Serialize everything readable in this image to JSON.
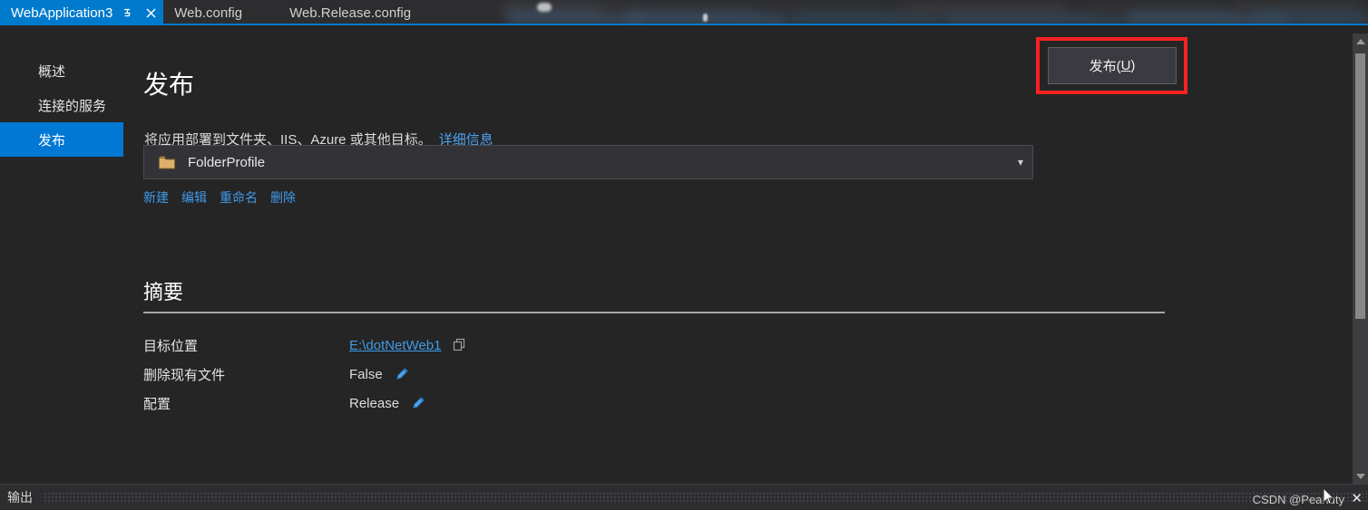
{
  "tabs": [
    {
      "label": "WebApplication3",
      "active": true,
      "pin_icon": "pin-icon",
      "close_icon": "close-icon"
    },
    {
      "label": "Web.config",
      "active": false
    },
    {
      "label": "Web.Release.config",
      "active": false
    }
  ],
  "sidebar": {
    "items": [
      {
        "label": "概述",
        "selected": false
      },
      {
        "label": "连接的服务",
        "selected": false
      },
      {
        "label": "发布",
        "selected": true
      }
    ]
  },
  "main": {
    "title": "发布",
    "subtitle": "将应用部署到文件夹、IIS、Azure 或其他目标。",
    "subtitle_link": "详细信息",
    "profile": {
      "icon": "folder-icon",
      "value": "FolderProfile",
      "chevron": "chevron-down-icon"
    },
    "profile_actions": [
      {
        "label": "新建"
      },
      {
        "label": "编辑"
      },
      {
        "label": "重命名"
      },
      {
        "label": "删除"
      }
    ],
    "publish_button": {
      "label_before": "发布(",
      "accelerator": "U",
      "label_after": ")"
    },
    "summary": {
      "heading": "摘要",
      "rows": [
        {
          "label": "目标位置",
          "value": "E:\\dotNetWeb1",
          "value_is_link": true,
          "icon": "copy-icon"
        },
        {
          "label": "删除现有文件",
          "value": "False",
          "value_is_link": false,
          "icon": "edit-pencil-icon"
        },
        {
          "label": "配置",
          "value": "Release",
          "value_is_link": false,
          "icon": "edit-pencil-icon"
        }
      ]
    }
  },
  "statusbar": {
    "output_label": "输出",
    "watermark": "CSDN @Peanuty",
    "close_label": "✕"
  },
  "colors": {
    "accent": "#007acc",
    "selected_nav": "#0078d4",
    "link": "#3f9ae8",
    "annotation": "#fa2222",
    "background": "#252526",
    "folder": "#dfb069"
  }
}
